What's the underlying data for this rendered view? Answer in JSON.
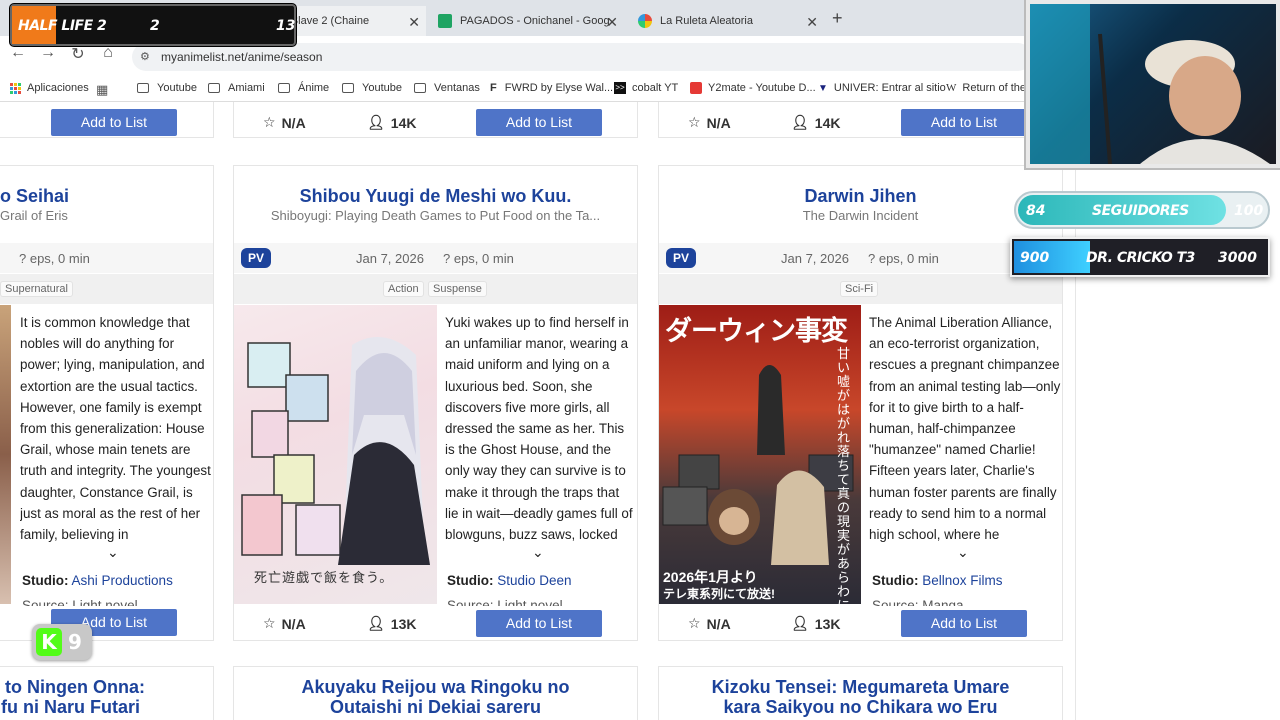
{
  "browser": {
    "tabs": [
      {
        "label": "i no Slave 2 (Chaine"
      },
      {
        "label": "PAGADOS - Onichanel - Google"
      },
      {
        "label": "La Ruleta Aleatoria"
      }
    ],
    "new_tab": "+",
    "url": "myanimelist.net/anime/season",
    "bookmarks": [
      "Aplicaciones",
      "Youtube",
      "Amiami",
      "Ánime",
      "Youtube",
      "Ventanas",
      "FWRD by Elyse Wal...",
      "cobalt YT",
      "Y2mate - Youtube D...",
      "UNIVER: Entrar al sitio",
      "Return of the"
    ]
  },
  "top_row": {
    "cards": [
      {
        "button": "Add to List"
      },
      {
        "score": "N/A",
        "members": "14K",
        "button": "Add to List"
      },
      {
        "score": "N/A",
        "members": "14K",
        "button": "Add to List"
      }
    ]
  },
  "cards": [
    {
      "title": "o Seihai",
      "subtitle": "Grail of Eris",
      "eps": "? eps, 0 min",
      "genres": [
        "Supernatural"
      ],
      "synopsis": "It is common knowledge that nobles will do anything for power; lying, manipulation, and extortion are the usual tactics. However, one family is exempt from this generalization: House Grail, whose main tenets are truth and integrity. The youngest daughter, Constance Grail, is just as moral as the rest of her family, believing in",
      "studio_label": "Studio:",
      "studio": "Ashi Productions",
      "source": "Source: Light novel",
      "button": "Add to List"
    },
    {
      "title": "Shibou Yuugi de Meshi wo Kuu.",
      "subtitle": "Shiboyugi: Playing Death Games to Put Food on the Ta...",
      "pv": "PV",
      "date": "Jan 7, 2026",
      "eps": "? eps, 0 min",
      "genres": [
        "Action",
        "Suspense"
      ],
      "synopsis": "Yuki wakes up to find herself in an unfamiliar manor, wearing a maid uniform and lying on a luxurious bed. Soon, she discovers five more girls, all dressed the same as her. This is the Ghost House, and the only way they can survive is to make it through the traps that lie in wait—deadly games full of blowguns, buzz saws, locked",
      "studio_label": "Studio:",
      "studio": "Studio Deen",
      "source": "Source: Light novel",
      "score": "N/A",
      "members": "13K",
      "button": "Add to List",
      "poster_text": "死亡遊戯で飯を食う。"
    },
    {
      "title": "Darwin Jihen",
      "subtitle": "The Darwin Incident",
      "pv": "PV",
      "date": "Jan 7, 2026",
      "eps": "? eps, 0 min",
      "genres": [
        "Sci-Fi"
      ],
      "synopsis": "The Animal Liberation Alliance, an eco-terrorist organization, rescues a pregnant chimpanzee from an animal testing lab—only for it to give birth to a half-human, half-chimpanzee \"humanzee\" named Charlie! Fifteen years later, Charlie's human foster parents are finally ready to send him to a normal high school, where he",
      "studio_label": "Studio:",
      "studio": "Bellnox Films",
      "source": "Source: Manga",
      "score": "N/A",
      "members": "13K",
      "button": "Add to List",
      "poster_title": "ダーウィン事変",
      "poster_vertical": "甘い嘘がはがれ落ちて真の現実があらわになる",
      "poster_date": "2026年1月より",
      "poster_tv": "テレ東系列にて放送!"
    }
  ],
  "bottom_titles": [
    {
      "line1": "to Ningen Onna:",
      "line2": "fu ni Naru Futari"
    },
    {
      "line1": "Akuyaku Reijou wa Ringoku no",
      "line2": "Outaishi ni Dekiai sareru"
    },
    {
      "line1": "Kizoku Tensei: Megumareta Umare",
      "line2": "kara Saikyou no Chikara wo Eru"
    }
  ],
  "overlays": {
    "game_title": "HALF LIFE 2",
    "game_a": "2",
    "game_b": "13",
    "followers_current": "84",
    "followers_label": "SEGUIDORES",
    "followers_goal": "100",
    "goal_current": "900",
    "goal_label": "DR. CRICKO T3",
    "goal_target": "3000",
    "followers_progress": 0.84,
    "goal_progress": 0.3,
    "kick_letter": "K",
    "kick_count": "9",
    "colors": {
      "accent": "#1d439b",
      "button": "#4f74c8",
      "cyan": "#3fd0d8",
      "orange": "#f07a1a"
    }
  }
}
